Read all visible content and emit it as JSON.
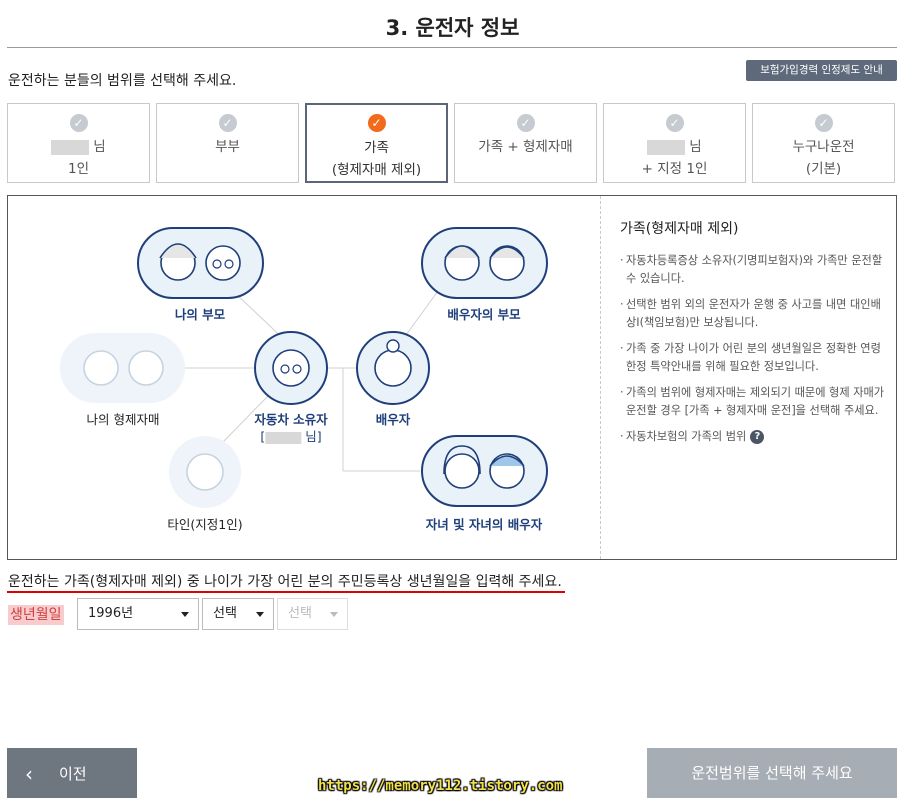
{
  "page": {
    "title": "3. 운전자 정보",
    "subtitle": "운전하는 분들의 범위를 선택해 주세요.",
    "guide_button": "보험가입경력 인정제도 안내"
  },
  "options": [
    {
      "line1": "님",
      "line2": "1인",
      "selected": false
    },
    {
      "line1": "부부",
      "line2": "",
      "selected": false
    },
    {
      "line1": "가족",
      "line2": "(형제자매 제외)",
      "selected": true
    },
    {
      "line1": "가족 + 형제자매",
      "line2": "",
      "selected": false
    },
    {
      "line1": "님",
      "line2": "+ 지정 1인",
      "selected": false
    },
    {
      "line1": "누구나운전",
      "line2": "(기본)",
      "selected": false
    }
  ],
  "diagram": {
    "my_parents": "나의 부모",
    "spouse_parents": "배우자의 부모",
    "my_siblings": "나의 형제자매",
    "owner": "자동차 소유자",
    "owner_name_open": "[",
    "owner_name_close": "님]",
    "spouse": "배우자",
    "other": "타인(지정1인)",
    "children": "자녀 및 자녀의 배우자"
  },
  "info": {
    "title": "가족(형제자매 제외)",
    "items": [
      "자동차등록증상 소유자(기명피보험자)와 가족만 운전할 수 있습니다.",
      "선택한 범위 외의 운전자가 운행 중 사고를 내면 대인배상I(책임보험)만 보상됩니다.",
      "가족 중 가장 나이가 어린 분의 생년월일은 정확한 연령한정 특약안내를 위해 필요한 정보입니다.",
      "가족의 범위에 형제자매는 제외되기 때문에 형제 자매가 운전할 경우 [가족 + 형제자매 운전]을 선택해 주세요.",
      "자동차보험의 가족의 범위"
    ],
    "help_icon": "?"
  },
  "birth": {
    "question": "운전하는 가족(형제자매 제외) 중 나이가 가장 어린 분의 주민등록상 생년월일을 입력해 주세요.",
    "label": "생년월일",
    "year": "1996년",
    "month": "선택",
    "day": "선택"
  },
  "nav": {
    "prev": "이전",
    "prev_icon": "‹",
    "next": "운전범위를 선택해 주세요"
  },
  "watermark": "https://memory112.tistory.com",
  "colors": {
    "accent": "#f26b1d",
    "navy": "#1f3f7a",
    "button_gray": "#6e7680",
    "disabled_gray": "#a7adb4",
    "guide_bg": "#5e6a7b"
  }
}
